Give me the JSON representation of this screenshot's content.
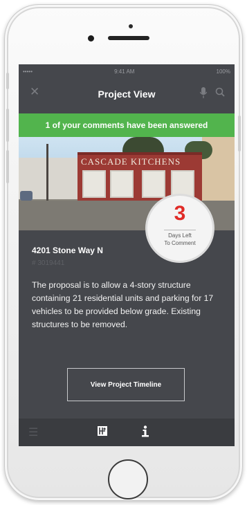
{
  "status_bar": {
    "carrier": "•••••  ",
    "time": "9:41 AM",
    "battery": "100%"
  },
  "nav": {
    "title": "Project View",
    "close_icon": "close-icon",
    "mic_icon": "microphone-icon",
    "search_icon": "search-icon"
  },
  "banner": {
    "text": "1 of your comments have been answered",
    "color": "#52b44d"
  },
  "photo": {
    "sign_text": "CASCADE  KITCHENS"
  },
  "countdown": {
    "days": "3",
    "label_line1": "Days Left",
    "label_line2": "To Comment",
    "color": "#e02b27"
  },
  "project": {
    "address": "4201 Stone Way N",
    "number": "# 3019441",
    "description": "The proposal is to allow a 4-story structure containing 21 residential units and parking for 17 vehicles to be provided below grade. Existing structures to be removed."
  },
  "actions": {
    "timeline_label": "View Project Timeline"
  },
  "tab_bar": {
    "menu_icon": "menu-icon",
    "map_icon": "map-icon",
    "info_icon": "info-icon"
  }
}
